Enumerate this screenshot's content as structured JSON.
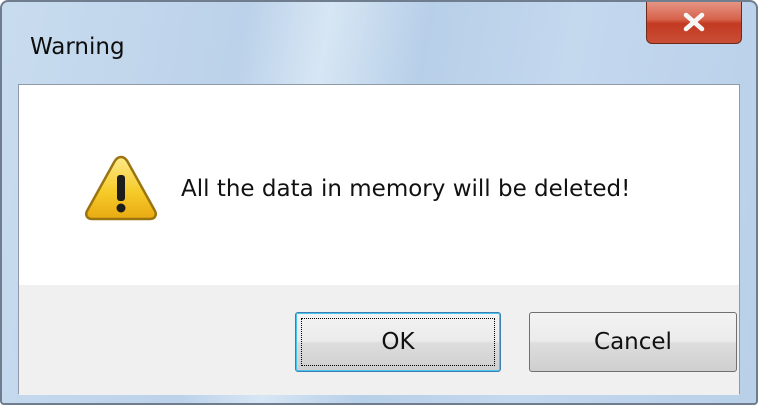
{
  "window": {
    "title": "Warning",
    "close_icon": "close-x-icon"
  },
  "dialog": {
    "icon": "warning-triangle-icon",
    "message": "All the data in memory will be deleted!"
  },
  "buttons": {
    "ok_label": "OK",
    "cancel_label": "Cancel"
  },
  "colors": {
    "close_button": "#c94d35",
    "warning_icon": "#f3c21a",
    "default_button_border": "#3c7fb1"
  }
}
